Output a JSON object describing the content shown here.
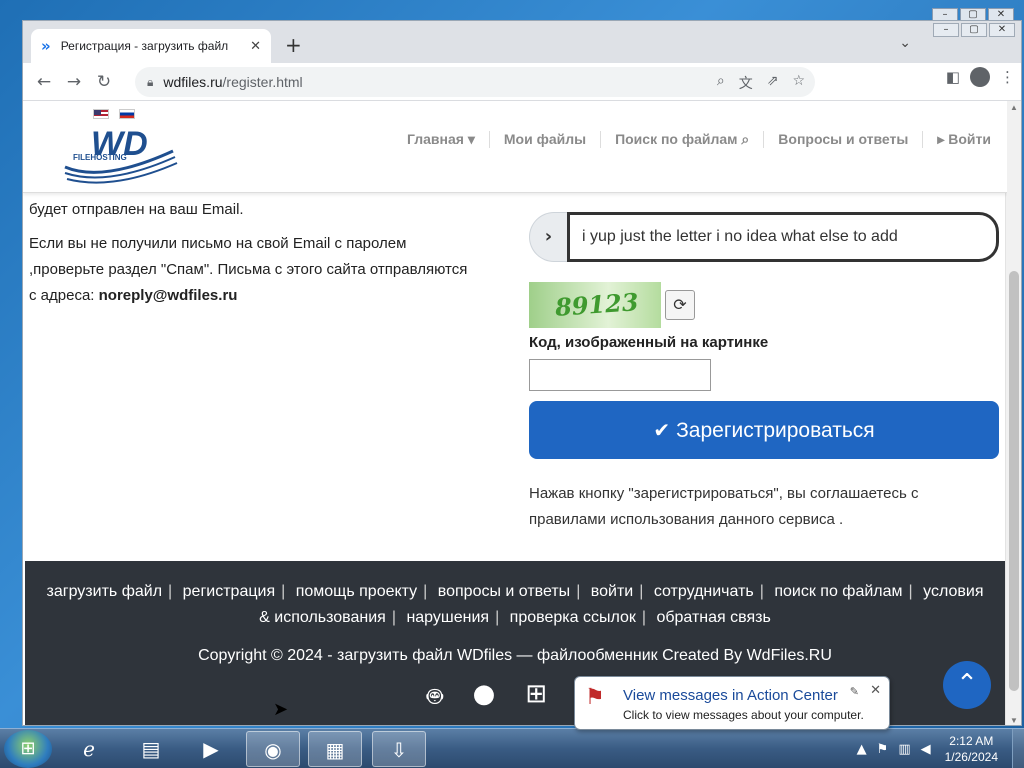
{
  "browser": {
    "tab_title": "Регистрация - загрузить файл",
    "url_host": "wdfiles.ru",
    "url_path": "/register.html"
  },
  "site": {
    "logo_text": "WD",
    "logo_sub": "FILEHOSTING",
    "nav": [
      {
        "label": "Главная ▾"
      },
      {
        "label": "Мои файлы"
      },
      {
        "label": "Поиск по файлам ⌕"
      },
      {
        "label": "Вопросы и ответы"
      },
      {
        "label": "▸ Войти"
      }
    ]
  },
  "left": {
    "line1": "будет отправлен на ваш Email.",
    "para2_a": "Если вы не получили письмо на свой Email с паролем ,проверьте раздел \"Спам\". Письма с этого сайта отправляются с адреса: ",
    "email": "noreply@wdfiles.ru"
  },
  "form": {
    "addon_icon": "chevron-right",
    "text_value": "i yup just the letter i no idea what else to add",
    "captcha_code": "89123",
    "captcha_label": "Код, изображенный на картинке",
    "captcha_value": "",
    "register_label": "Зарегистрироваться",
    "terms": "Нажав кнопку \"зарегистрироваться\", вы соглашаетесь с правилами использования данного сервиса ."
  },
  "footer": {
    "links": [
      "загрузить файл",
      "регистрация",
      "помощь проекту",
      "вопросы и ответы",
      "войти",
      "сотрудничать",
      "поиск по файлам",
      "условия & использования",
      "нарушения",
      "проверка ссылок",
      "обратная связь"
    ],
    "copyright": "Copyright © 2024 - загрузить файл WDfiles — файлообменник Created By WdFiles.RU"
  },
  "notification": {
    "title": "View messages in Action Center",
    "text": "Click to view messages about your computer."
  },
  "taskbar": {
    "time": "2:12 AM",
    "date": "1/26/2024"
  },
  "colors": {
    "primary": "#1f66c2",
    "footer_bg": "#2f343b"
  }
}
